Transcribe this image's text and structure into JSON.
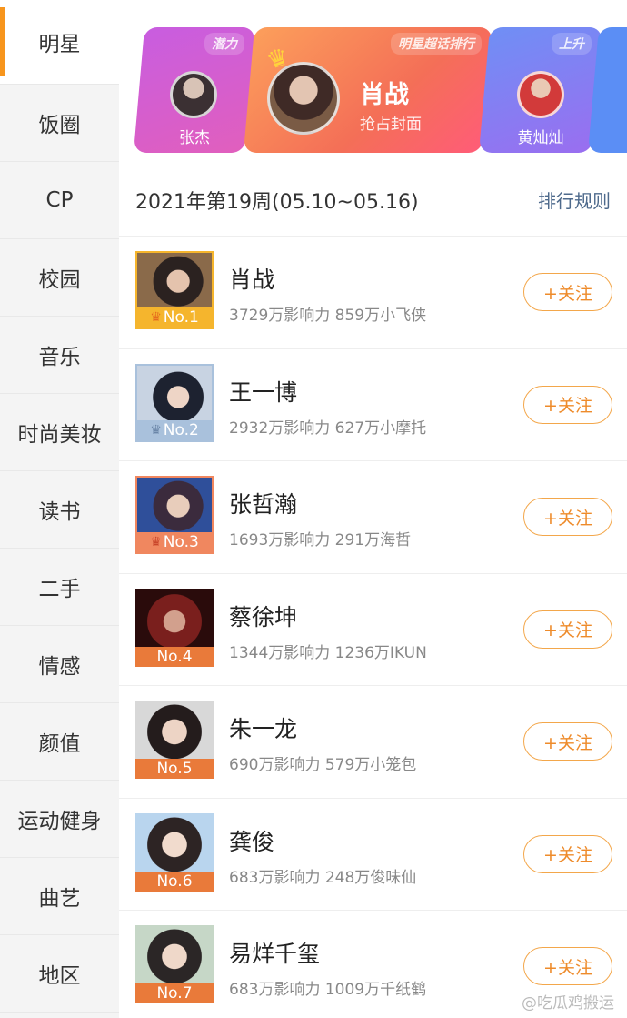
{
  "sidebar": {
    "items": [
      {
        "label": "明星"
      },
      {
        "label": "饭圈"
      },
      {
        "label": "CP"
      },
      {
        "label": "校园"
      },
      {
        "label": "音乐"
      },
      {
        "label": "时尚美妆"
      },
      {
        "label": "读书"
      },
      {
        "label": "二手"
      },
      {
        "label": "情感"
      },
      {
        "label": "颜值"
      },
      {
        "label": "运动健身"
      },
      {
        "label": "曲艺"
      },
      {
        "label": "地区"
      }
    ]
  },
  "banner": {
    "left": {
      "tag": "潜力",
      "name": "张杰"
    },
    "main": {
      "tag": "明星超话排行",
      "name": "肖战",
      "subtitle": "抢占封面"
    },
    "right": {
      "tag": "上升",
      "name": "黄灿灿"
    }
  },
  "week": {
    "label": "2021年第19周(05.10~05.16)",
    "rules_link": "排行规则"
  },
  "rankings": [
    {
      "rank": "No.1",
      "name": "肖战",
      "stats": "3729万影响力 859万小飞侠",
      "follow": "+关注",
      "label_color": "#f5b52d"
    },
    {
      "rank": "No.2",
      "name": "王一博",
      "stats": "2932万影响力 627万小摩托",
      "follow": "+关注",
      "label_color": "#a9c1dc"
    },
    {
      "rank": "No.3",
      "name": "张哲瀚",
      "stats": "1693万影响力 291万海哲",
      "follow": "+关注",
      "label_color": "#f0875f"
    },
    {
      "rank": "No.4",
      "name": "蔡徐坤",
      "stats": "1344万影响力 1236万IKUN",
      "follow": "+关注",
      "label_color": "#e97a3a"
    },
    {
      "rank": "No.5",
      "name": "朱一龙",
      "stats": "690万影响力 579万小笼包",
      "follow": "+关注",
      "label_color": "#e97a3a"
    },
    {
      "rank": "No.6",
      "name": "龚俊",
      "stats": "683万影响力 248万俊味仙",
      "follow": "+关注",
      "label_color": "#e97a3a"
    },
    {
      "rank": "No.7",
      "name": "易烊千玺",
      "stats": "683万影响力 1009万千纸鹤",
      "follow": "+关注",
      "label_color": "#e97a3a"
    }
  ],
  "watermark": "@吃瓜鸡搬运",
  "colors": {
    "accent": "#f7951d",
    "follow_border": "#f3a74b",
    "follow_text": "#ee8b2b"
  }
}
